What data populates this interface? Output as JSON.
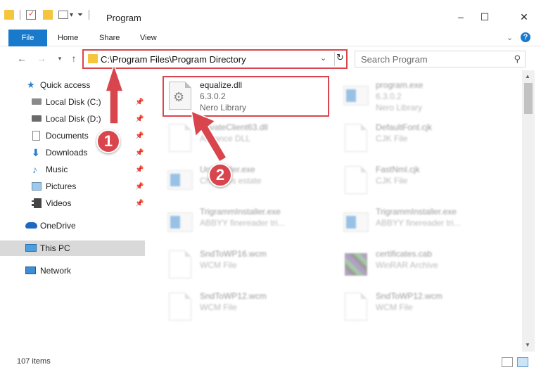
{
  "window": {
    "title": "Program",
    "minimize": "–",
    "maximize": "☐",
    "close": "✕"
  },
  "ribbon": {
    "tabs": [
      "File",
      "Home",
      "Share",
      "View"
    ],
    "help": "?",
    "collapse": "⌄"
  },
  "address": {
    "path": "C:\\Program Files\\Program Directory",
    "dropdown": "⌄",
    "refresh": "↻"
  },
  "search": {
    "placeholder": "Search Program",
    "icon": "⚲"
  },
  "sidebar": {
    "items": [
      {
        "label": "Quick access",
        "icon": "star-icon",
        "pinned": false
      },
      {
        "label": "Local Disk (C:)",
        "icon": "drive-icon",
        "pinned": true
      },
      {
        "label": "Local Disk (D:)",
        "icon": "drive-icon",
        "pinned": true
      },
      {
        "label": "Documents",
        "icon": "documents-icon",
        "pinned": true
      },
      {
        "label": "Downloads",
        "icon": "download-icon",
        "pinned": true
      },
      {
        "label": "Music",
        "icon": "music-icon",
        "pinned": true
      },
      {
        "label": "Pictures",
        "icon": "pictures-icon",
        "pinned": true
      },
      {
        "label": "Videos",
        "icon": "videos-icon",
        "pinned": true
      },
      {
        "label": "OneDrive",
        "icon": "cloud-icon",
        "pinned": false
      },
      {
        "label": "This PC",
        "icon": "computer-icon",
        "pinned": false
      },
      {
        "label": "Network",
        "icon": "network-icon",
        "pinned": false
      }
    ],
    "pin_glyph": "📌"
  },
  "files": [
    {
      "name": "equalize.dll",
      "version": "6.3.0.2",
      "desc": "Nero Library",
      "kind": "dll",
      "highlight": true
    },
    {
      "name": "program.exe",
      "version": "6.3.0.2",
      "desc": "Nero Library",
      "kind": "exe",
      "highlight": false
    },
    {
      "name": "PrivateClient63.dll",
      "version": "",
      "desc": "Advance DLL",
      "kind": "dll",
      "highlight": false
    },
    {
      "name": "DefaultFont.cjk",
      "version": "",
      "desc": "CJK File",
      "kind": "doc",
      "highlight": false
    },
    {
      "name": "Uninstaller.exe",
      "version": "",
      "desc": "Chadates estate",
      "kind": "exe",
      "highlight": false
    },
    {
      "name": "FastNml.cjk",
      "version": "",
      "desc": "CJK File",
      "kind": "doc",
      "highlight": false
    },
    {
      "name": "TrigrammInstaller.exe",
      "version": "",
      "desc": "ABBYY finereader tri...",
      "kind": "exe",
      "highlight": false
    },
    {
      "name": "TrigrammInstaller.exe",
      "version": "",
      "desc": "ABBYY finereader tri...",
      "kind": "exe",
      "highlight": false
    },
    {
      "name": "SndToWP16.wcm",
      "version": "",
      "desc": "WCM File",
      "kind": "doc",
      "highlight": false
    },
    {
      "name": "certificates.cab",
      "version": "",
      "desc": "WinRAR Archive",
      "kind": "cab",
      "highlight": false
    },
    {
      "name": "SndToWP12.wcm",
      "version": "",
      "desc": "WCM File",
      "kind": "doc",
      "highlight": false
    },
    {
      "name": "SndToWP12.wcm",
      "version": "",
      "desc": "WCM File",
      "kind": "doc",
      "highlight": false
    }
  ],
  "status": {
    "count": "107 items"
  },
  "annotations": {
    "step1": "1",
    "step2": "2",
    "color": "#d9454c"
  }
}
